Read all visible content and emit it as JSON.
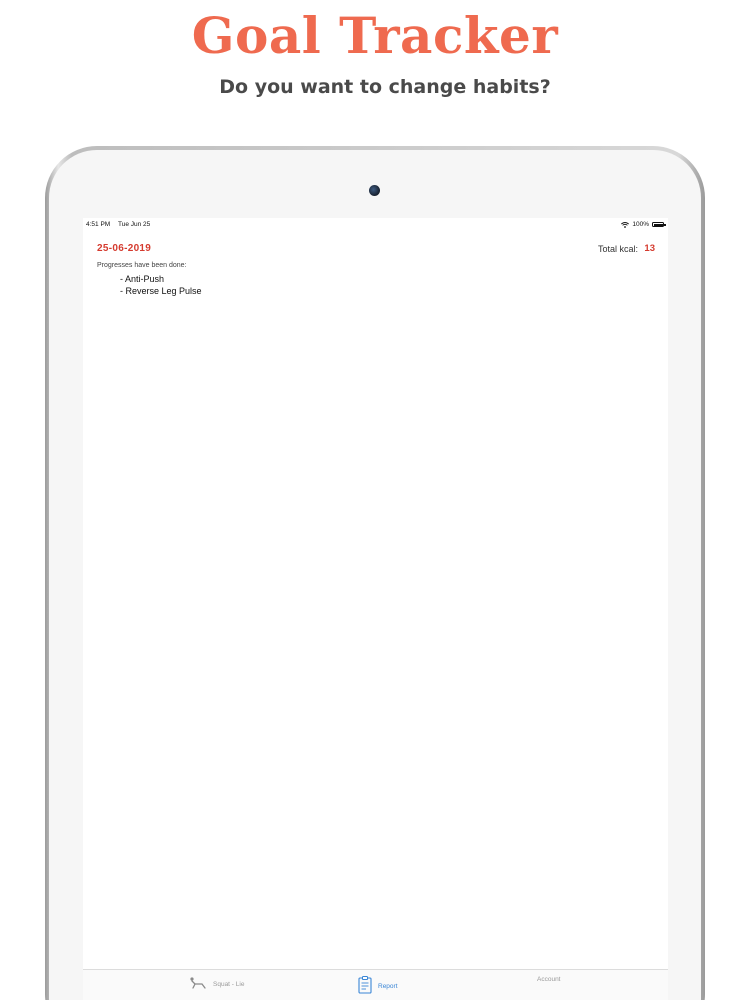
{
  "hero": {
    "title": "Goal Tracker",
    "subtitle": "Do you want to change habits?"
  },
  "status_bar": {
    "time": "4:51 PM",
    "date": "Tue Jun 25",
    "battery": "100%",
    "battery_level": 1.0
  },
  "report": {
    "date": "25-06-2019",
    "kcal_label": "Total kcal:",
    "kcal_value": "13",
    "progress_header": "Progresses have been done:",
    "progress_items": [
      "- Anti-Push",
      "- Reverse Leg Pulse"
    ]
  },
  "tabs": [
    {
      "label": "Squat - Lie",
      "icon": "squat-icon",
      "active": false
    },
    {
      "label": "Report",
      "icon": "report-icon",
      "active": true
    },
    {
      "label": "Account",
      "icon": "",
      "active": false
    }
  ],
  "colors": {
    "brand": "#ef6a4f",
    "accent_red": "#d53b2f",
    "active_tab": "#3a86d6",
    "inactive_tab": "#9a9a9a"
  }
}
